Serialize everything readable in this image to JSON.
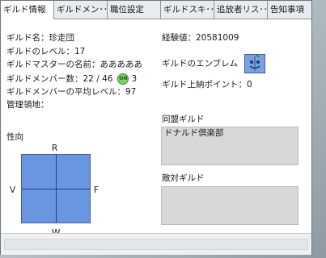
{
  "tabs": [
    {
      "label": "ギルド情報"
    },
    {
      "label": "ギルドメン･･･"
    },
    {
      "label": "職位設定"
    },
    {
      "label": "ギルドスキ･･･"
    },
    {
      "label": "追放者リス･･･"
    },
    {
      "label": "告知事項"
    }
  ],
  "guild": {
    "name_line": "ギルド名：珍走団",
    "level_line": "ギルドのレベル：17",
    "master_line": "ギルドマスターの名前：あああああ",
    "members_line": "ギルドメンバー数：22 / 46",
    "online_badge": "ON",
    "online_count": "3",
    "avg_level_line": "ギルドメンバーの平均レベル：97",
    "territory_line": "管理領地：",
    "exp_line": "経験値：20581009",
    "emblem_label": "ギルドのエンブレム",
    "points_line": "ギルド上納ポイント：0"
  },
  "tendency": {
    "title": "性向",
    "top": "R",
    "bottom": "W",
    "left": "V",
    "right": "F"
  },
  "alliance": {
    "title": "同盟ギルド",
    "entries": [
      "ドナルド倶楽部"
    ]
  },
  "hostile": {
    "title": "敵対ギルド"
  },
  "colors": {
    "pad_fill": "#6a95e0",
    "emblem_fill": "#6f95d8"
  }
}
